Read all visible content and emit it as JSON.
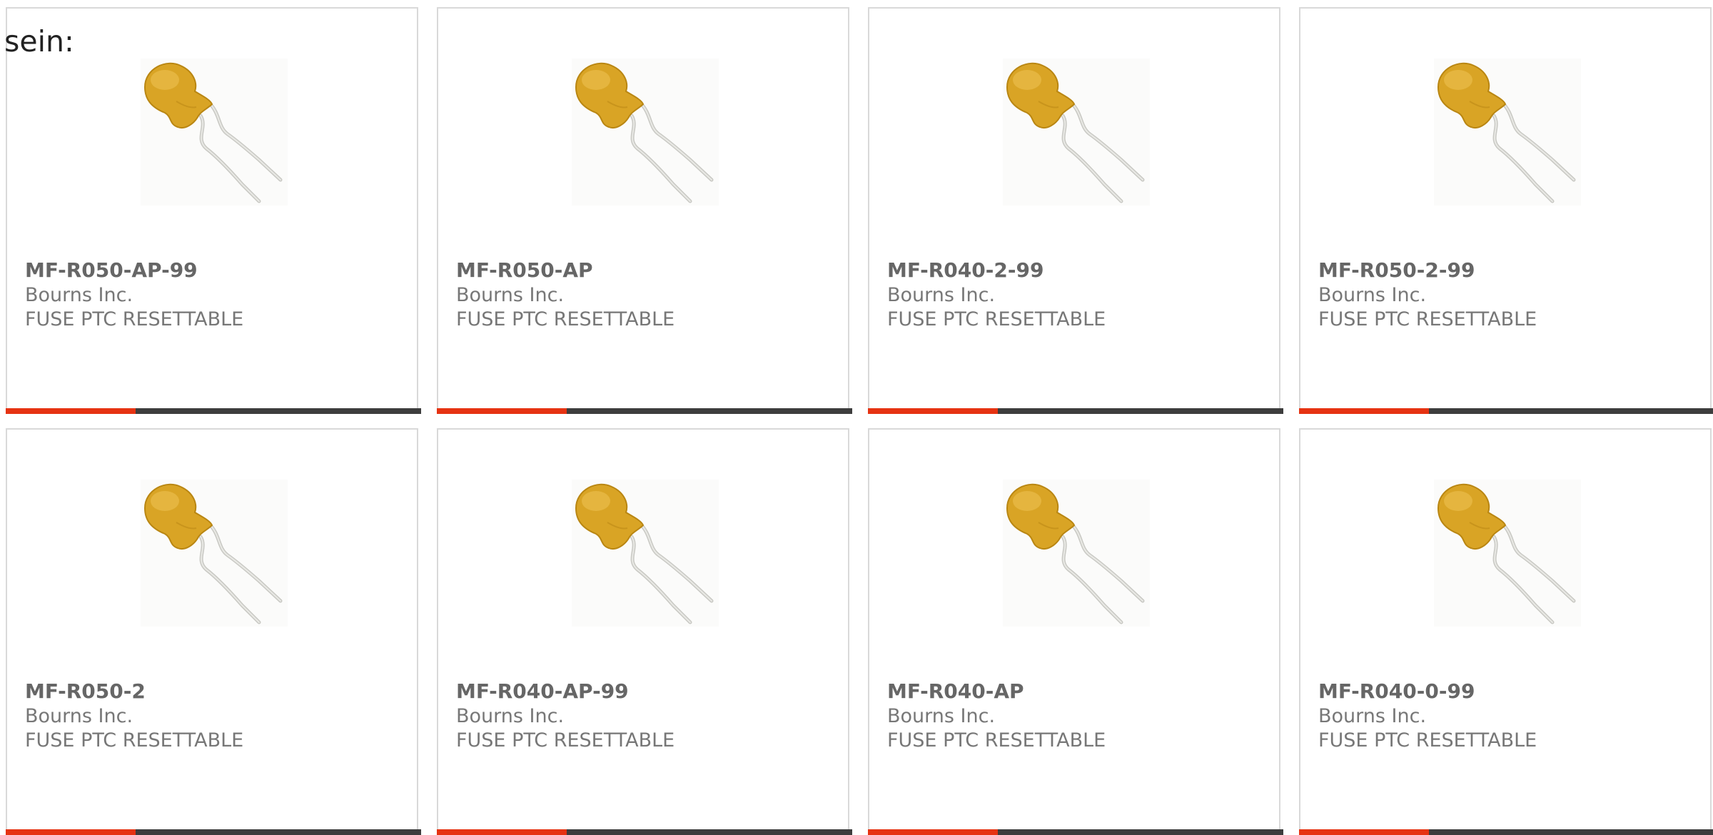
{
  "intro_text": "sein:",
  "colors": {
    "accent": "#e63312",
    "bar": "#3d3d3d",
    "card_border": "#d9d9d9",
    "text_muted": "#777777",
    "part_text": "#666666"
  },
  "products": [
    {
      "part": "MF-R050-AP-99",
      "manufacturer": "Bourns Inc.",
      "description": "FUSE PTC RESETTABLE",
      "image": "ptc-fuse-image"
    },
    {
      "part": "MF-R050-AP",
      "manufacturer": "Bourns Inc.",
      "description": "FUSE PTC RESETTABLE",
      "image": "ptc-fuse-image"
    },
    {
      "part": "MF-R040-2-99",
      "manufacturer": "Bourns Inc.",
      "description": "FUSE PTC RESETTABLE",
      "image": "ptc-fuse-image"
    },
    {
      "part": "MF-R050-2-99",
      "manufacturer": "Bourns Inc.",
      "description": "FUSE PTC RESETTABLE",
      "image": "ptc-fuse-image"
    },
    {
      "part": "MF-R050-2",
      "manufacturer": "Bourns Inc.",
      "description": "FUSE PTC RESETTABLE",
      "image": "ptc-fuse-image"
    },
    {
      "part": "MF-R040-AP-99",
      "manufacturer": "Bourns Inc.",
      "description": "FUSE PTC RESETTABLE",
      "image": "ptc-fuse-image"
    },
    {
      "part": "MF-R040-AP",
      "manufacturer": "Bourns Inc.",
      "description": "FUSE PTC RESETTABLE",
      "image": "ptc-fuse-image"
    },
    {
      "part": "MF-R040-0-99",
      "manufacturer": "Bourns Inc.",
      "description": "FUSE PTC RESETTABLE",
      "image": "ptc-fuse-image"
    }
  ]
}
